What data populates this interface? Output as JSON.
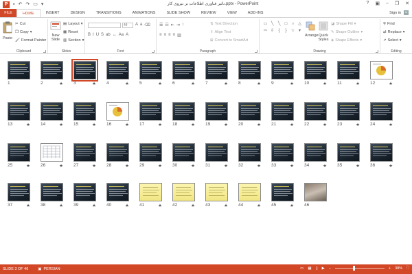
{
  "window": {
    "title": "تاثیر فناوری اطلاعات بر نیروی کار.pptx - PowerPoint",
    "app_logo": "P",
    "qat": [
      "save-icon",
      "undo-icon",
      "redo-icon",
      "present-icon",
      "customize-icon"
    ],
    "controls": [
      "help-icon",
      "ribbon-display-icon",
      "minimize-icon",
      "restore-icon",
      "close-icon"
    ]
  },
  "tabs": {
    "file": "FILE",
    "items": [
      "HOME",
      "INSERT",
      "DESIGN",
      "TRANSITIONS",
      "ANIMATIONS",
      "SLIDE SHOW",
      "REVIEW",
      "VIEW",
      "ADD-INS"
    ],
    "active": "HOME",
    "signin": "Sign in"
  },
  "ribbon": {
    "clipboard": {
      "label": "Clipboard",
      "paste": "Paste",
      "cut": "Cut",
      "copy": "Copy",
      "format_painter": "Format Painter"
    },
    "slides": {
      "label": "Slides",
      "new_slide": "New",
      "new_slide_2": "Slide",
      "layout": "Layout",
      "reset": "Reset",
      "section": "Section"
    },
    "font": {
      "label": "Font",
      "size_value": "44"
    },
    "paragraph": {
      "label": "Paragraph",
      "text_direction": "Text Direction",
      "align_text": "Align Text",
      "convert_smartart": "Convert to SmartArt"
    },
    "drawing": {
      "label": "Drawing",
      "arrange": "Arrange",
      "quick_styles": "Quick",
      "quick_styles_2": "Styles",
      "shape_fill": "Shape Fill",
      "shape_outline": "Shape Outline",
      "shape_effects": "Shape Effects"
    },
    "editing": {
      "label": "Editing",
      "find": "Find",
      "replace": "Replace",
      "select": "Select"
    }
  },
  "slides": [
    {
      "n": "1",
      "star": "",
      "type": "dark"
    },
    {
      "n": "2",
      "star": "★",
      "type": "dark"
    },
    {
      "n": "3",
      "star": "★",
      "type": "dark",
      "selected": true
    },
    {
      "n": "4",
      "star": "★",
      "type": "dark"
    },
    {
      "n": "5",
      "star": "★",
      "type": "dark"
    },
    {
      "n": "6",
      "star": "★",
      "type": "dark"
    },
    {
      "n": "7",
      "star": "★",
      "type": "dark"
    },
    {
      "n": "8",
      "star": "★",
      "type": "dark"
    },
    {
      "n": "9",
      "star": "★",
      "type": "dark"
    },
    {
      "n": "10",
      "star": "★",
      "type": "dark"
    },
    {
      "n": "11",
      "star": "★",
      "type": "dark"
    },
    {
      "n": "12",
      "star": "★",
      "type": "chart"
    },
    {
      "n": "13",
      "star": "★",
      "type": "dark"
    },
    {
      "n": "14",
      "star": "★",
      "type": "dark"
    },
    {
      "n": "15",
      "star": "★",
      "type": "dark"
    },
    {
      "n": "16",
      "star": "★",
      "type": "chart"
    },
    {
      "n": "17",
      "star": "★",
      "type": "dark"
    },
    {
      "n": "18",
      "star": "★",
      "type": "dark"
    },
    {
      "n": "19",
      "star": "★",
      "type": "dark"
    },
    {
      "n": "20",
      "star": "★",
      "type": "dark"
    },
    {
      "n": "21",
      "star": "★",
      "type": "dark"
    },
    {
      "n": "22",
      "star": "★",
      "type": "dark"
    },
    {
      "n": "23",
      "star": "★",
      "type": "dark"
    },
    {
      "n": "24",
      "star": "★",
      "type": "dark"
    },
    {
      "n": "25",
      "star": "★",
      "type": "dark"
    },
    {
      "n": "26",
      "star": "★",
      "type": "table"
    },
    {
      "n": "27",
      "star": "★",
      "type": "dark"
    },
    {
      "n": "28",
      "star": "★",
      "type": "dark"
    },
    {
      "n": "29",
      "star": "★",
      "type": "dark"
    },
    {
      "n": "30",
      "star": "★",
      "type": "dark"
    },
    {
      "n": "31",
      "star": "★",
      "type": "dark"
    },
    {
      "n": "32",
      "star": "★",
      "type": "dark"
    },
    {
      "n": "33",
      "star": "★",
      "type": "dark"
    },
    {
      "n": "34",
      "star": "★",
      "type": "dark"
    },
    {
      "n": "35",
      "star": "★",
      "type": "dark"
    },
    {
      "n": "36",
      "star": "★",
      "type": "dark"
    },
    {
      "n": "37",
      "star": "★",
      "type": "dark"
    },
    {
      "n": "38",
      "star": "★",
      "type": "dark"
    },
    {
      "n": "39",
      "star": "★",
      "type": "dark"
    },
    {
      "n": "40",
      "star": "★",
      "type": "dark"
    },
    {
      "n": "41",
      "star": "★",
      "type": "yellow"
    },
    {
      "n": "42",
      "star": "★",
      "type": "yellow"
    },
    {
      "n": "43",
      "star": "★",
      "type": "yellow"
    },
    {
      "n": "44",
      "star": "★",
      "type": "yellow"
    },
    {
      "n": "45",
      "star": "★",
      "type": "dark"
    },
    {
      "n": "46",
      "star": "",
      "type": "photo"
    }
  ],
  "status": {
    "slide_counter": "SLIDE 3 OF 46",
    "language": "PERSIAN",
    "zoom": "38%",
    "zoom_fraction": 0.38
  },
  "colors": {
    "accent": "#d24726",
    "thumb_text": "#e8d25a"
  }
}
